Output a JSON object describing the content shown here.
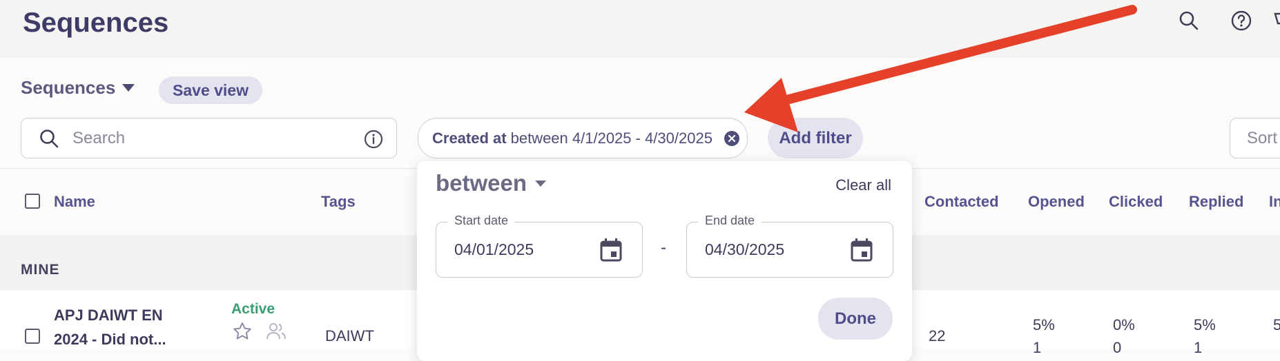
{
  "page": {
    "title": "Sequences"
  },
  "toolbar": {
    "view_name": "Sequences",
    "save_view_label": "Save view",
    "search_placeholder": "Search",
    "add_filter_label": "Add filter",
    "sort_label": "Sort"
  },
  "filter_chip": {
    "key": "Created at",
    "value": "between 4/1/2025 - 4/30/2025"
  },
  "table": {
    "headers": {
      "name": "Name",
      "tags": "Tags",
      "contacted": "Contacted",
      "opened": "Opened",
      "clicked": "Clicked",
      "replied": "Replied",
      "interested": "In"
    },
    "group_label": "MINE",
    "row": {
      "name_line1": "APJ DAIWT EN",
      "name_line2": "2024 - Did not...",
      "status": "Active",
      "tag": "DAIWT",
      "contacted": "22",
      "opened": "5%",
      "opened_sub": "1",
      "clicked": "0%",
      "clicked_sub": "0",
      "replied": "5%",
      "replied_sub": "1",
      "interested": "5"
    }
  },
  "popover": {
    "operator": "between",
    "clear_all_label": "Clear all",
    "start_label": "Start date",
    "start_value": "04/01/2025",
    "separator": "-",
    "end_label": "End date",
    "end_value": "04/30/2025",
    "done_label": "Done"
  },
  "colors": {
    "accent": "#4e4d8a",
    "status_active": "#3a9e75",
    "annotation_arrow": "#e5402a"
  }
}
